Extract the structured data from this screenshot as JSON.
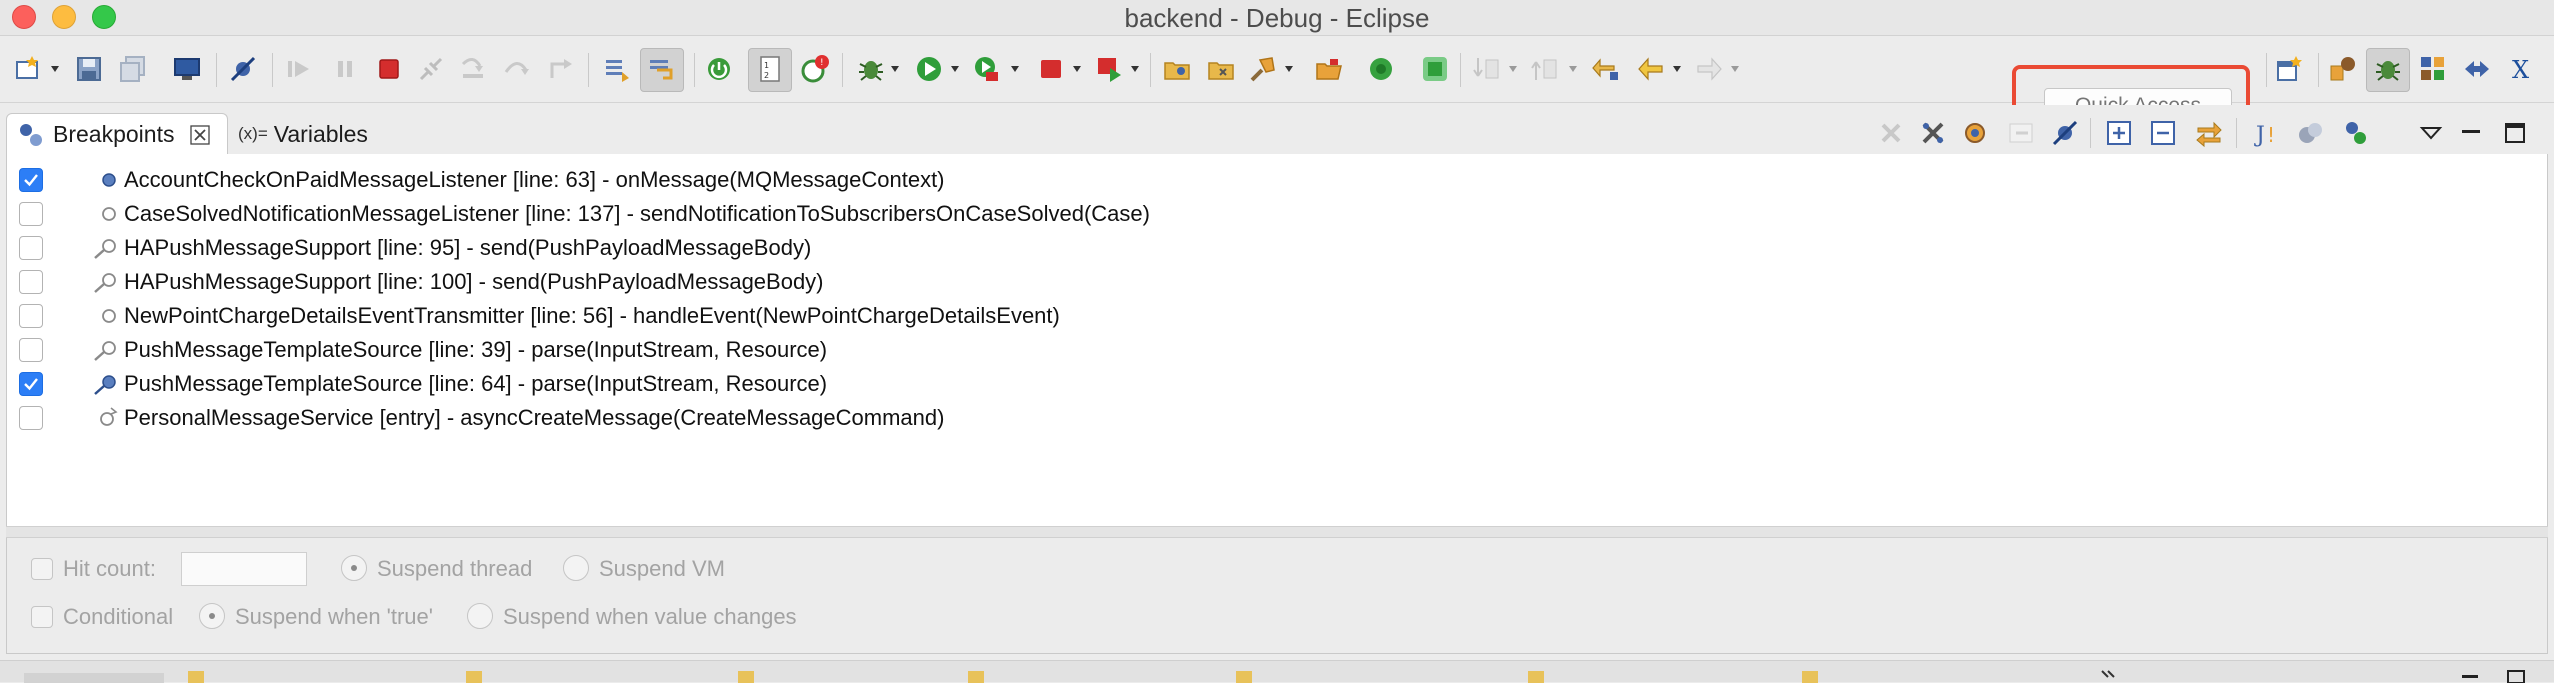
{
  "window": {
    "title": "backend - Debug - Eclipse"
  },
  "toolbar": {
    "quick_access_placeholder": "Quick Access",
    "highlight_color": "#ea4a34"
  },
  "tabs": [
    {
      "label": "Breakpoints",
      "icon": "breakpoints-icon",
      "active": true
    },
    {
      "label": "Variables",
      "prefix": "(x)=",
      "icon": "variables-icon",
      "active": false
    }
  ],
  "breakpoints": [
    {
      "checked": true,
      "icon": "method-breakpoint-icon",
      "text": "AccountCheckOnPaidMessageListener [line: 63] - onMessage(MQMessageContext)"
    },
    {
      "checked": false,
      "icon": "method-breakpoint-icon",
      "text": "CaseSolvedNotificationMessageListener [line: 137] - sendNotificationToSubscribersOnCaseSolved(Case)"
    },
    {
      "checked": false,
      "icon": "line-breakpoint-icon",
      "text": "HAPushMessageSupport [line: 95] - send(PushPayloadMessageBody)"
    },
    {
      "checked": false,
      "icon": "line-breakpoint-icon",
      "text": "HAPushMessageSupport [line: 100] - send(PushPayloadMessageBody)"
    },
    {
      "checked": false,
      "icon": "method-breakpoint-icon",
      "text": "NewPointChargeDetailsEventTransmitter [line: 56] - handleEvent(NewPointChargeDetailsEvent)"
    },
    {
      "checked": false,
      "icon": "line-breakpoint-icon",
      "text": "PushMessageTemplateSource [line: 39] - parse(InputStream, Resource)"
    },
    {
      "checked": true,
      "icon": "line-breakpoint-icon",
      "text": "PushMessageTemplateSource [line: 64] - parse(InputStream, Resource)"
    },
    {
      "checked": false,
      "icon": "entry-breakpoint-icon",
      "text": "PersonalMessageService [entry] - asyncCreateMessage(CreateMessageCommand)"
    }
  ],
  "detail": {
    "hit_count_label": "Hit count:",
    "hit_count_value": "",
    "suspend_thread_label": "Suspend thread",
    "suspend_vm_label": "Suspend VM",
    "conditional_label": "Conditional",
    "suspend_true_label": "Suspend when 'true'",
    "suspend_changes_label": "Suspend when value changes"
  }
}
